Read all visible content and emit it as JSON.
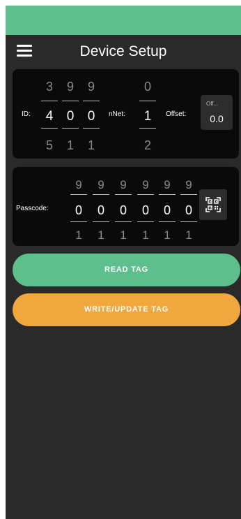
{
  "app": {
    "title": "Device Setup"
  },
  "colors": {
    "status_bar": "#5cbf8c",
    "background": "#2a2a2a",
    "card": "#0a0a0a",
    "read_button": "#5cbf8c",
    "write_button": "#f0a73e"
  },
  "icons": {
    "menu": "hamburger-menu-icon",
    "qr": "qr-code-scan-icon"
  },
  "device": {
    "id_label": "ID:",
    "id_digits": [
      {
        "prev": "3",
        "current": "4",
        "next": "5"
      },
      {
        "prev": "9",
        "current": "0",
        "next": "1"
      },
      {
        "prev": "9",
        "current": "0",
        "next": "1"
      }
    ],
    "nnet_label": "nNet:",
    "nnet": {
      "prev": "0",
      "current": "1",
      "next": "2"
    },
    "offset_label": "Offset:",
    "offset_placeholder": "Off...",
    "offset_value": "0.0"
  },
  "passcode": {
    "label": "Passcode:",
    "digits": [
      {
        "prev": "9",
        "current": "0",
        "next": "1"
      },
      {
        "prev": "9",
        "current": "0",
        "next": "1"
      },
      {
        "prev": "9",
        "current": "0",
        "next": "1"
      },
      {
        "prev": "9",
        "current": "0",
        "next": "1"
      },
      {
        "prev": "9",
        "current": "0",
        "next": "1"
      },
      {
        "prev": "9",
        "current": "0",
        "next": "1"
      }
    ]
  },
  "buttons": {
    "read": "READ TAG",
    "write": "WRITE/UPDATE TAG"
  }
}
